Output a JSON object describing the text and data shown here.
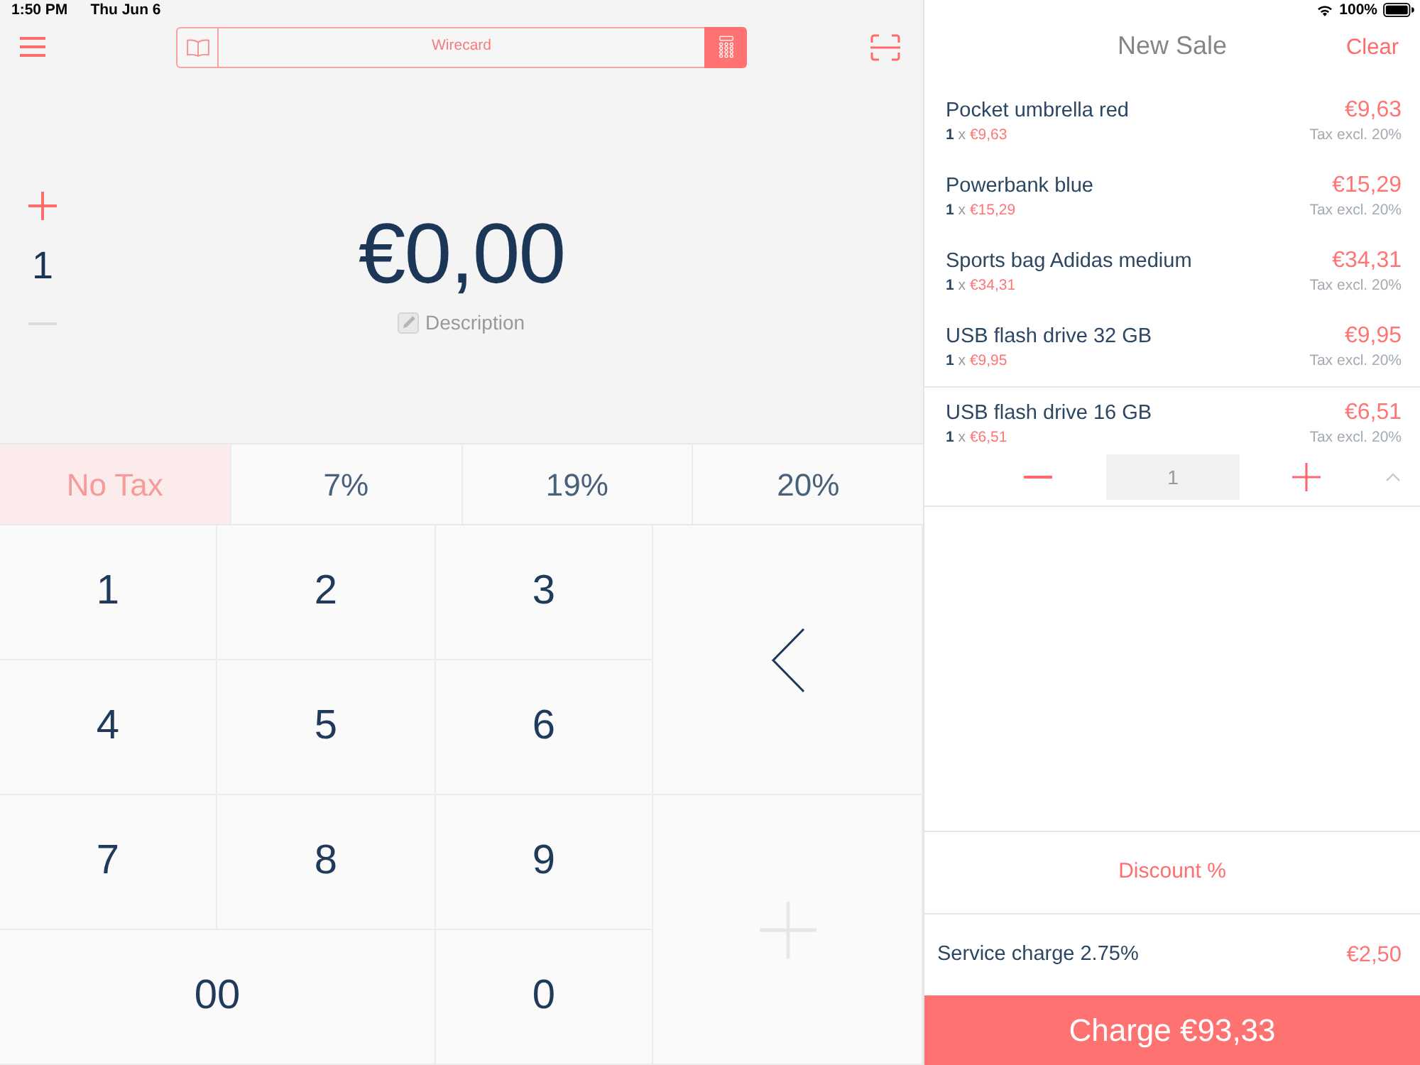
{
  "status_bar": {
    "time": "1:50 PM",
    "date": "Thu Jun 6",
    "battery": "100%"
  },
  "toolbar": {
    "catalog": "Wirecard"
  },
  "entry": {
    "quantity": "1",
    "decrease_disabled": true,
    "amount": "€0,00",
    "description": "Description"
  },
  "tax_rates": [
    {
      "label": "No Tax",
      "selected": true
    },
    {
      "label": "7%",
      "selected": false
    },
    {
      "label": "19%",
      "selected": false
    },
    {
      "label": "20%",
      "selected": false
    }
  ],
  "keypad": {
    "rows": [
      [
        "1",
        "2",
        "3"
      ],
      [
        "4",
        "5",
        "6"
      ],
      [
        "7",
        "8",
        "9"
      ],
      [
        "00",
        "",
        "0"
      ]
    ],
    "side_keys": [
      {
        "kind": "backspace",
        "disabled": false
      },
      {
        "kind": "add",
        "disabled": true
      }
    ]
  },
  "cart": {
    "title": "New Sale",
    "clear": "Clear",
    "items": [
      {
        "name": "Pocket umbrella red",
        "quantity": "1",
        "times": "x",
        "unit_price": "€9,63",
        "total": "€9,63",
        "tax": "Tax excl. 20%",
        "expanded": false
      },
      {
        "name": "Powerbank blue",
        "quantity": "1",
        "times": "x",
        "unit_price": "€15,29",
        "total": "€15,29",
        "tax": "Tax excl. 20%",
        "expanded": false
      },
      {
        "name": "Sports bag Adidas medium",
        "quantity": "1",
        "times": "x",
        "unit_price": "€34,31",
        "total": "€34,31",
        "tax": "Tax excl. 20%",
        "expanded": false
      },
      {
        "name": "USB flash drive 32 GB",
        "quantity": "1",
        "times": "x",
        "unit_price": "€9,95",
        "total": "€9,95",
        "tax": "Tax excl. 20%",
        "expanded": false
      },
      {
        "name": "USB flash drive 16 GB",
        "quantity": "1",
        "times": "x",
        "unit_price": "€6,51",
        "total": "€6,51",
        "tax": "Tax excl. 20%",
        "expanded": true,
        "stepper_value": "1"
      }
    ],
    "discount": "Discount %",
    "service_charge": {
      "label": "Service charge 2.75%",
      "amount": "€2,50"
    },
    "charge_button": "Charge €93,33"
  }
}
